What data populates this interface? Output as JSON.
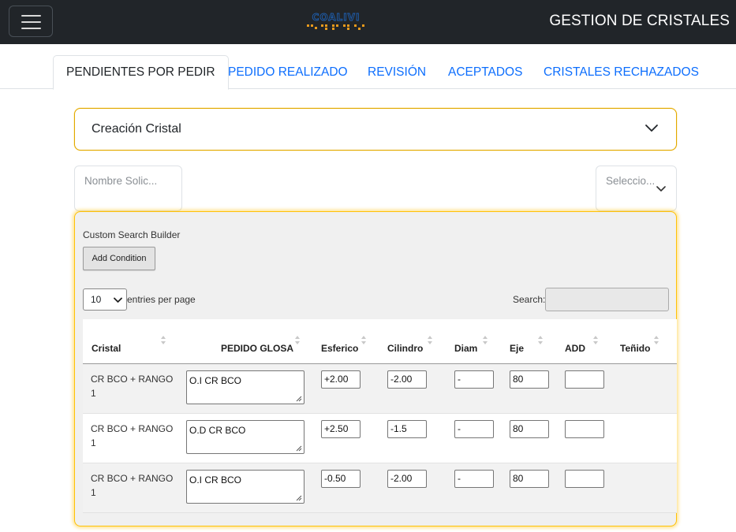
{
  "navbar": {
    "title": "GESTION DE CRISTALES",
    "logo_text": "COALIVI",
    "menu_icon": "hamburger-icon"
  },
  "tabs": [
    {
      "label": "PENDIENTES POR PEDIR",
      "active": true
    },
    {
      "label": "PEDIDO REALIZADO",
      "active": false
    },
    {
      "label": "REVISIÓN",
      "active": false
    },
    {
      "label": "ACEPTADOS",
      "active": false
    },
    {
      "label": "CRISTALES RECHAZADOS",
      "active": false
    }
  ],
  "accordion": {
    "label": "Creación Cristal",
    "icon": "chevron-down-icon"
  },
  "filters": {
    "name_placeholder": "Nombre Solic...",
    "select_placeholder": "Seleccio..."
  },
  "search_builder": {
    "title": "Custom Search Builder",
    "add_condition_label": "Add Condition"
  },
  "table_controls": {
    "page_length": "10",
    "length_label": "entries per page",
    "search_label": "Search:",
    "search_value": ""
  },
  "table": {
    "columns": [
      "Cristal",
      "PEDIDO GLOSA",
      "Esferico",
      "Cilindro",
      "Diam",
      "Eje",
      "ADD",
      "Teñido"
    ],
    "rows": [
      {
        "cristal": "CR BCO + RANGO 1",
        "pedido_glosa": "O.I CR BCO",
        "esferico": "+2.00",
        "cilindro": "-2.00",
        "diam": "-",
        "eje": "80",
        "add": ""
      },
      {
        "cristal": "CR BCO + RANGO 1",
        "pedido_glosa": "O.D CR BCO",
        "esferico": "+2.50",
        "cilindro": "-1.5",
        "diam": "-",
        "eje": "80",
        "add": ""
      },
      {
        "cristal": "CR BCO + RANGO 1",
        "pedido_glosa": "O.I CR BCO",
        "esferico": "-0.50",
        "cilindro": "-2.00",
        "diam": "-",
        "eje": "80",
        "add": ""
      }
    ]
  },
  "colors": {
    "navbar": "#212529",
    "tab_link": "#0d6efd",
    "accent": "#ffc107",
    "panel_bg": "#f0f0f0"
  }
}
